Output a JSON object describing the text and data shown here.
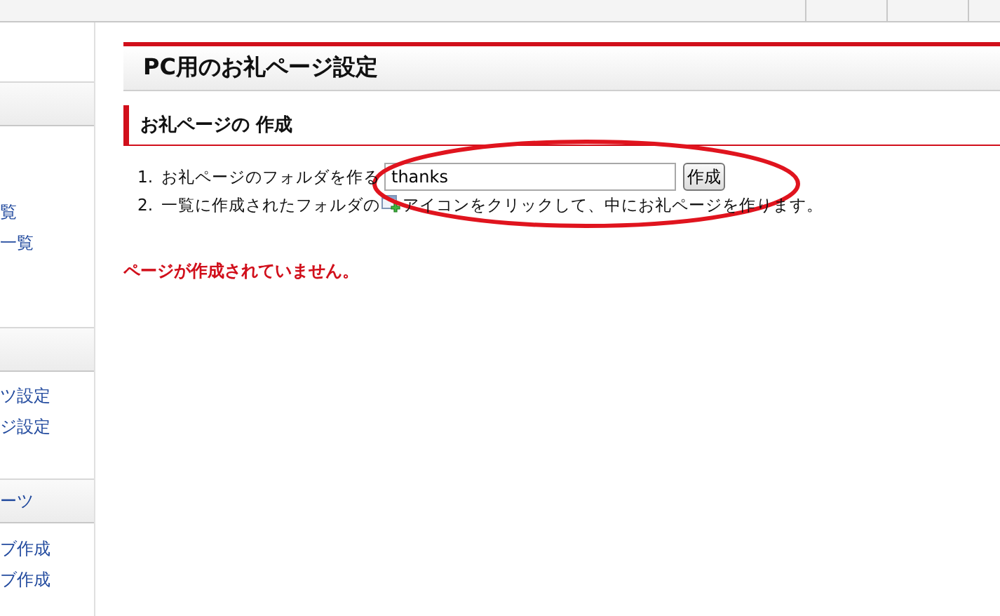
{
  "sidebar": {
    "sections": [
      {
        "items": [
          "覧",
          "一覧"
        ]
      },
      {
        "items": [
          "ツ設定",
          "ジ設定"
        ]
      },
      {
        "header": "ーツ",
        "items": [
          "ブ作成",
          "ブ作成"
        ]
      }
    ]
  },
  "page_title": "PC用のお礼ページ設定",
  "section_title": "お礼ページの 作成",
  "steps": [
    {
      "number": "1.",
      "parts": [
        {
          "kind": "text",
          "text": "お礼ページのフォルダを作る"
        },
        {
          "kind": "field",
          "value": "thanks"
        },
        {
          "kind": "button",
          "label": "作成"
        }
      ]
    },
    {
      "number": "2.",
      "parts": [
        {
          "kind": "text",
          "text": "一覧に作成されたフォルダの"
        },
        {
          "kind": "icon"
        },
        {
          "kind": "text",
          "text": "アイコンをクリックして、中にお礼ページを作ります。"
        }
      ]
    }
  ],
  "error_message": "ページが作成されていません。",
  "annotation": {
    "kind": "ellipse"
  }
}
